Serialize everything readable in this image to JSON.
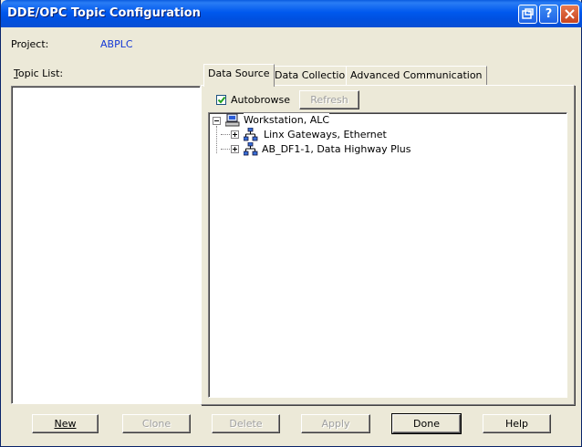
{
  "window": {
    "title": "DDE/OPC Topic Configuration",
    "controls": [
      "restore-icon",
      "help-icon",
      "close-icon"
    ]
  },
  "project": {
    "label": "Project:",
    "value": "ABPLC"
  },
  "topic_list": {
    "label": "Topic List:",
    "items": []
  },
  "tabs": [
    {
      "label": "Data Source",
      "active": true
    },
    {
      "label": "Data Collection",
      "active": false
    },
    {
      "label": "Advanced Communication",
      "active": false
    }
  ],
  "data_source": {
    "autobrowse_label": "Autobrowse",
    "autobrowse_checked": true,
    "refresh_label": "Refresh"
  },
  "tree": {
    "root": {
      "label": "Workstation, ALC",
      "icon": "workstation-icon",
      "expanded": true
    },
    "children": [
      {
        "label": "Linx Gateways, Ethernet",
        "icon": "network-icon",
        "expanded": false
      },
      {
        "label": "AB_DF1-1, Data Highway Plus",
        "icon": "network-icon",
        "expanded": false
      }
    ]
  },
  "buttons": {
    "new": "New",
    "clone": "Clone",
    "delete": "Delete",
    "apply": "Apply",
    "done": "Done",
    "help": "Help"
  },
  "colors": {
    "titlebar": "#0058ee",
    "window_bg": "#ece9d8",
    "project_value": "#1438d6",
    "disabled_text": "#a0a0a0"
  }
}
